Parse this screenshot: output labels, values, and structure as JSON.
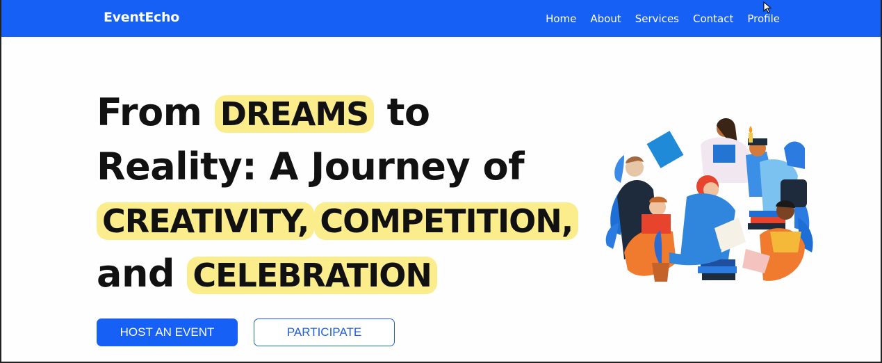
{
  "nav": {
    "brand": "EventEcho",
    "links": [
      "Home",
      "About",
      "Services",
      "Contact",
      "Profile"
    ]
  },
  "hero": {
    "line1_pre": "From ",
    "line1_hl": "DREAMS",
    "line1_post": " to",
    "line2": "Reality: A Journey of",
    "line3_hl1": "CREATIVITY,",
    "line3_hl2": "COMPETITION,",
    "line4_pre": "and ",
    "line4_hl": "CELEBRATION"
  },
  "buttons": {
    "host": "HOST AN EVENT",
    "participate": "PARTICIPATE"
  },
  "colors": {
    "primary": "#1660f5",
    "highlight": "#fbec8c"
  },
  "icons": {
    "cursor": "mouse-pointer-icon",
    "illustration": "people-reading-illustration"
  }
}
